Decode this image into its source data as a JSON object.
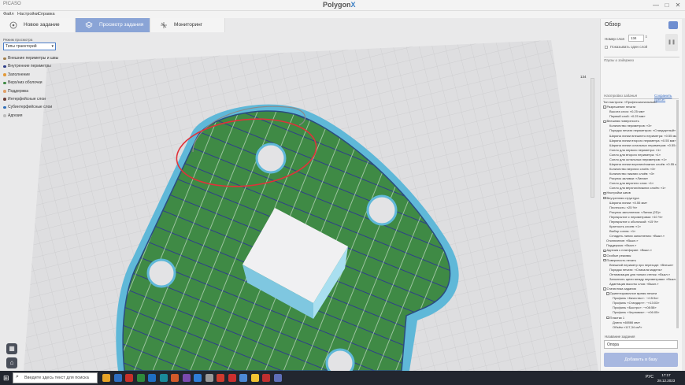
{
  "window": {
    "app_name": "PICASO",
    "logo_text": "Polygon",
    "logo_mark": "X",
    "controls": [
      "—",
      "□",
      "✕"
    ]
  },
  "menu": [
    "Файл",
    "Настройки",
    "Справка"
  ],
  "tabs": [
    {
      "label": "Новое задание",
      "icon": "printer-icon",
      "active": false
    },
    {
      "label": "Просмотр задания",
      "icon": "layers-icon",
      "active": true
    },
    {
      "label": "Мониторинг",
      "icon": "monitor-icon",
      "active": false
    }
  ],
  "left_panel": {
    "mode_label": "Режим просмотра",
    "mode_value": "Типы траекторий",
    "legend": [
      {
        "label": "Внешние периметры и швы",
        "color": "#a07e4a"
      },
      {
        "label": "Внутренние периметры",
        "color": "#2f3f8a"
      },
      {
        "label": "Заполнение",
        "color": "#e39a3a"
      },
      {
        "label": "Верх/низ оболочки",
        "color": "#3f8a45"
      },
      {
        "label": "Поддержка",
        "color": "#e1a06a"
      },
      {
        "label": "Интерфейсные слои",
        "color": "#6b3f3a"
      },
      {
        "label": "Субинтерфейсные слои",
        "color": "#2f6fb8"
      },
      {
        "label": "Адгезия",
        "color": "#bdbdbd"
      }
    ]
  },
  "viewport": {
    "layer_top": "134"
  },
  "right_panel": {
    "title": "Обзор",
    "layer_label": "Номер слоя",
    "layer_value": "134",
    "show_one_layer": "Показывать один слой",
    "pauses_header": "Паузы и задержки",
    "settings_header": "Настройки задания",
    "save_preset": "Сохранить пресет",
    "tree": [
      {
        "indent": 0,
        "toggle": "",
        "text": "Тип настроек: «Профессиональный»"
      },
      {
        "indent": 0,
        "toggle": "-",
        "text": "Разрешение печати"
      },
      {
        "indent": 2,
        "toggle": "",
        "text": "Высота слоя: «0.25 мм»"
      },
      {
        "indent": 2,
        "toggle": "",
        "text": "Первый слой: «0.25 мм»"
      },
      {
        "indent": 0,
        "toggle": "-",
        "text": "Внешняя поверхность"
      },
      {
        "indent": 2,
        "toggle": "",
        "text": "Количество периметров: «3»"
      },
      {
        "indent": 2,
        "toggle": "",
        "text": "Порядок печати периметров: «Стандартный»"
      },
      {
        "indent": 2,
        "toggle": "",
        "text": "Ширина линии внешнего периметра: «0.55 мм»"
      },
      {
        "indent": 2,
        "toggle": "",
        "text": "Ширина линии второго периметра: «0.55 мм»"
      },
      {
        "indent": 2,
        "toggle": "",
        "text": "Ширина линии остальных периметров: «0.55 мм»"
      },
      {
        "indent": 2,
        "toggle": "",
        "text": "Сопло для первого периметра: «1»"
      },
      {
        "indent": 2,
        "toggle": "",
        "text": "Сопло для второго периметра: «1»"
      },
      {
        "indent": 2,
        "toggle": "",
        "text": "Сопло для остальных периметров: «1»"
      },
      {
        "indent": 2,
        "toggle": "",
        "text": "Ширина линии верхних/нижних слоёв: «0.55 мм»"
      },
      {
        "indent": 2,
        "toggle": "",
        "text": "Количество верхних слоёв: «3»"
      },
      {
        "indent": 2,
        "toggle": "",
        "text": "Количество нижних слоёв: «3»"
      },
      {
        "indent": 2,
        "toggle": "",
        "text": "Рисунок заливки: «Линии»"
      },
      {
        "indent": 2,
        "toggle": "",
        "text": "Сопло для верхнего слоя: «1»"
      },
      {
        "indent": 2,
        "toggle": "",
        "text": "Сопло для верхних/нижних слоёв: «1»"
      },
      {
        "indent": 0,
        "toggle": "+",
        "text": "Настройки швов"
      },
      {
        "indent": 0,
        "toggle": "-",
        "text": "Внутренняя структура"
      },
      {
        "indent": 2,
        "toggle": "",
        "text": "Ширина линии: «0.55 мм»"
      },
      {
        "indent": 2,
        "toggle": "",
        "text": "Плотность: «25 %»"
      },
      {
        "indent": 2,
        "toggle": "",
        "text": "Рисунок заполнения: «Линии (2D)»"
      },
      {
        "indent": 2,
        "toggle": "",
        "text": "Перекрытие с периметрами: «10 %»"
      },
      {
        "indent": 2,
        "toggle": "",
        "text": "Перекрытие с оболочкой: «15 %»"
      },
      {
        "indent": 2,
        "toggle": "",
        "text": "Кратность слоев: «1»"
      },
      {
        "indent": 2,
        "toggle": "",
        "text": "Выбор сопла: «1»"
      },
      {
        "indent": 2,
        "toggle": "",
        "text": "Сгладить линии заполнения: «Выкл.»"
      },
      {
        "indent": 1,
        "toggle": "",
        "text": "Отключение: «Выкл.»"
      },
      {
        "indent": 1,
        "toggle": "",
        "text": "Поддержка: «Выкл.»"
      },
      {
        "indent": 0,
        "toggle": "+",
        "text": "Адгезия к платформе: «Выкл.»"
      },
      {
        "indent": 0,
        "toggle": "+",
        "text": "Особые режимы"
      },
      {
        "indent": 0,
        "toggle": "-",
        "text": "Поверхность печать"
      },
      {
        "indent": 2,
        "toggle": "",
        "text": "Внешний периметр при переходе: «Внешн»"
      },
      {
        "indent": 2,
        "toggle": "",
        "text": "Порядок печати: «Сначала модель»"
      },
      {
        "indent": 2,
        "toggle": "",
        "text": "Оптимизация для тонких стенок: «Выкл.»"
      },
      {
        "indent": 2,
        "toggle": "",
        "text": "Заполнить щели между периметрами: «Выкл.»"
      },
      {
        "indent": 2,
        "toggle": "",
        "text": "Адаптация высоты слоя: «Выкл.»"
      },
      {
        "indent": 0,
        "toggle": "-",
        "text": "Статистика задания"
      },
      {
        "indent": 1,
        "toggle": "-",
        "text": "Ориентировочное время печати"
      },
      {
        "indent": 3,
        "toggle": "",
        "text": "Профиль «Качество»: ~«15:5х»"
      },
      {
        "indent": 3,
        "toggle": "",
        "text": "Профиль «Стандарт»: ~«13:03»"
      },
      {
        "indent": 3,
        "toggle": "",
        "text": "Профиль «Быстро»: ~«08:58»"
      },
      {
        "indent": 3,
        "toggle": "",
        "text": "Профиль «Черновик»: ~«06:05»"
      },
      {
        "indent": 1,
        "toggle": "-",
        "text": "Пластик 1"
      },
      {
        "indent": 3,
        "toggle": "",
        "text": "Длина «48866 мм»"
      },
      {
        "indent": 3,
        "toggle": "",
        "text": "Объём «117,34 см³»"
      }
    ],
    "task_name_label": "Название задания",
    "task_name_value": "Опора",
    "add_queue_btn": "Добавить в базу"
  },
  "taskbar": {
    "search_placeholder": "Введите здесь текст для поиска",
    "lang": "РУС",
    "time": "17:17",
    "date": "28.12.2023",
    "app_colors": [
      "#e7a427",
      "#2f6fc1",
      "#c8312a",
      "#2e8a3c",
      "#1f6fc4",
      "#1a8a9a",
      "#d25a2a",
      "#7a4ab0",
      "#2f7ed8",
      "#9a9a9a",
      "#d03b2e",
      "#cc2f2f",
      "#4d8ad6",
      "#f1c232",
      "#c02f2f",
      "#5f6fb8"
    ]
  },
  "colors": {
    "accent": "#8aa4d6",
    "top_surface": "#3f8a45",
    "inner_perimeter": "#2f3f8a",
    "highlight": "#e0323a"
  }
}
